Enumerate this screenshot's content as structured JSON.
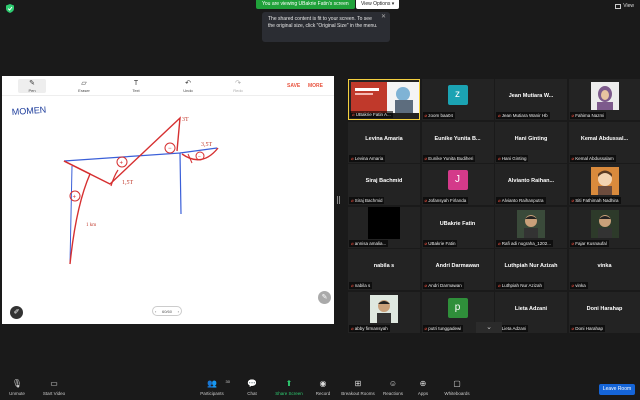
{
  "top": {
    "banner": "You are viewing UBakrie Fatin's screen",
    "view_options": "View Options ▾",
    "view": "View"
  },
  "tooltip": {
    "text": "The shared content is fit to your screen. To see the original size, click \"Original Size\" in the menu."
  },
  "whiteboard": {
    "tools": [
      {
        "label": "Pen",
        "icon": "pen-icon"
      },
      {
        "label": "Eraser",
        "icon": "eraser-icon"
      },
      {
        "label": "Text",
        "icon": "text-icon"
      },
      {
        "label": "Undo",
        "icon": "undo-icon"
      },
      {
        "label": "Redo",
        "icon": "redo-icon"
      }
    ],
    "save": "SAVE",
    "more": "MORE",
    "heading": "MOMEN",
    "annotations": [
      "3T",
      "3,5T",
      "1,5T",
      "1 km"
    ],
    "page": "60/60"
  },
  "gallery": {
    "tiles": [
      {
        "type": "photo-red",
        "label": "UBakrie Fatin A...",
        "speaking": true
      },
      {
        "type": "avatar",
        "letter": "z",
        "color": "#1ba3b3",
        "label": "zoom baa04"
      },
      {
        "type": "name",
        "name": "Jean Mutiara W...",
        "label": "Jean Mutiara Wanir Hb"
      },
      {
        "type": "photo-hijab",
        "label": "Fahima Nazmi"
      },
      {
        "type": "name",
        "name": "Levina Amaria",
        "label": "Levina Amaria"
      },
      {
        "type": "name",
        "name": "Eunike Yunita B...",
        "label": "Eunike Yunita Budiheri"
      },
      {
        "type": "name",
        "name": "Hani Ginting",
        "label": "Hani Ginting"
      },
      {
        "type": "name",
        "name": "Kemal Abdussal...",
        "label": "Kemal Abdussalam"
      },
      {
        "type": "name",
        "name": "Siraj Bachmid",
        "label": "Siraj Bachmid"
      },
      {
        "type": "avatar",
        "letter": "J",
        "color": "#d43a8a",
        "label": "Jofansyah Firlanda"
      },
      {
        "type": "name",
        "name": "Alvianto Raihan...",
        "label": "Alvianto Raihanputra"
      },
      {
        "type": "photo-face",
        "label": "Siti Fathimah Nadhira"
      },
      {
        "type": "black",
        "label": "annisa amalia..."
      },
      {
        "type": "name",
        "name": "UBakrie Fatin",
        "label": "UBakrie Fatin"
      },
      {
        "type": "photo-man",
        "label": "Rafi adi nugraha_1202..."
      },
      {
        "type": "photo-man2",
        "label": "Fajar Kusnaufal"
      },
      {
        "type": "name",
        "name": "nabila s",
        "label": "nabila s"
      },
      {
        "type": "name",
        "name": "Andri Darmawan",
        "label": "Andri Darmawan"
      },
      {
        "type": "name",
        "name": "Luthpiah Nur Azizah",
        "label": "Luthpiah Nur Azizah"
      },
      {
        "type": "name",
        "name": "vinka",
        "label": "vinka"
      },
      {
        "type": "photo-man3",
        "label": "abby firmansyah"
      },
      {
        "type": "avatar",
        "letter": "p",
        "color": "#2f8f3a",
        "label": "putri tunggadewi"
      },
      {
        "type": "name",
        "name": "Lieta Adzani",
        "label": "Lieta Adzani"
      },
      {
        "type": "name",
        "name": "Doni Harahap",
        "label": "Doni Harahap"
      }
    ]
  },
  "toolbar": {
    "unmute": "Unmute",
    "start_video": "Start Video",
    "participants": "Participants",
    "participants_count": "30",
    "chat": "Chat",
    "share_screen": "Share Screen",
    "record": "Record",
    "breakout": "Breakout Rooms",
    "reactions": "Reactions",
    "apps": "Apps",
    "whiteboards": "Whiteboards",
    "leave": "Leave Room"
  }
}
